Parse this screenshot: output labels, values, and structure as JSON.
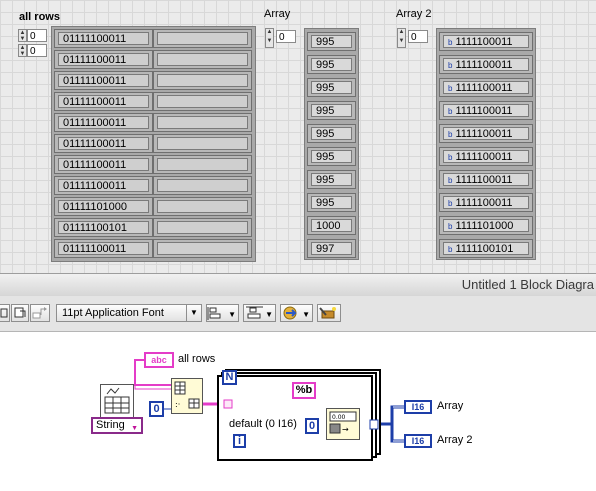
{
  "front_panel": {
    "all_rows": {
      "label": "all rows",
      "row_index": "0",
      "col_index": "0",
      "values": [
        "01111100011",
        "01111100011",
        "01111100011",
        "01111100011",
        "01111100011",
        "01111100011",
        "01111100011",
        "01111100011",
        "01111101000",
        "01111100101",
        "01111100011"
      ]
    },
    "array": {
      "label": "Array",
      "index": "0",
      "values": [
        "995",
        "995",
        "995",
        "995",
        "995",
        "995",
        "995",
        "995",
        "1000",
        "997"
      ]
    },
    "array2": {
      "label": "Array 2",
      "index": "0",
      "prefix": "b",
      "values": [
        "1111100011",
        "1111100011",
        "1111100011",
        "1111100011",
        "1111100011",
        "1111100011",
        "1111100011",
        "1111100011",
        "1111101000",
        "1111100101"
      ]
    }
  },
  "window": {
    "title": "Untitled 1 Block Diagra"
  },
  "toolbar": {
    "font": "11pt Application Font"
  },
  "diagram": {
    "all_rows_terminal": "abc",
    "all_rows_label": "all rows",
    "const_zero": "0",
    "string_enum": "String",
    "loop_n": "N",
    "loop_i": "i",
    "format_string": "%b",
    "default_label": "default (0 I16)",
    "default_zero": "0",
    "array_terminal": "I16",
    "array_label": "Array",
    "array2_terminal": "I16",
    "array2_label": "Array 2"
  },
  "colors": {
    "string_wire": "#e43cc8",
    "int_wire": "#1d3ea8",
    "bool_wire": "#1d9a2c"
  }
}
